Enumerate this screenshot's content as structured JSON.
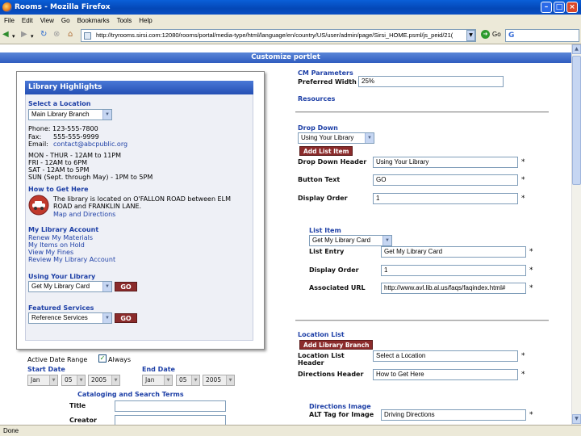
{
  "window": {
    "title": "Rooms - Mozilla Firefox",
    "controls": {
      "minimize": "–",
      "maximize": "□",
      "close": "×"
    }
  },
  "menubar": {
    "items": [
      "File",
      "Edit",
      "View",
      "Go",
      "Bookmarks",
      "Tools",
      "Help"
    ]
  },
  "navbar": {
    "url": "http://tryrooms.sirsi.com:12080/rooms/portal/media-type/html/language/en/country/US/user/admin/page/Sirsi_HOME.psml/js_peid/21(",
    "go_label": "Go",
    "search_logo": "G"
  },
  "status": {
    "text": "Done"
  },
  "portlet": {
    "title": "Customize portlet"
  },
  "library": {
    "header": "Library Highlights",
    "select_location_label": "Select a Location",
    "branch": "Main Library Branch",
    "phone": "Phone: 123-555-7800",
    "fax_label": "Fax:",
    "fax": "555-555-9999",
    "email_label": "Email:",
    "email": "contact@abcpublic.org",
    "hours": [
      "MON - THUR - 12AM to 11PM",
      "FRI - 12AM to 6PM",
      "SAT - 12AM to 5PM",
      "SUN (Sept. through May) - 1PM to 5PM"
    ],
    "how_heading": "How to Get Here",
    "how_text_1": "The library is located on O'FALLON ROAD between ELM",
    "how_text_2": "ROAD and FRANKLIN LANE.",
    "how_link": "Map and Directions",
    "account_heading": "My Library Account",
    "account_links": [
      "Renew My Materials",
      "My Items on Hold",
      "View My Fines",
      "Review My Library Account"
    ],
    "using_heading": "Using Your Library",
    "using_value": "Get My Library Card",
    "go": "GO",
    "featured_heading": "Featured Services",
    "featured_value": "Reference Services"
  },
  "date_range": {
    "active_label": "Active Date Range",
    "always_label": "Always",
    "always_checked": true,
    "start_label": "Start Date",
    "end_label": "End Date",
    "start": {
      "month": "Jan",
      "day": "05",
      "year": "2005"
    },
    "end": {
      "month": "Jan",
      "day": "05",
      "year": "2005"
    }
  },
  "catalog": {
    "heading": "Cataloging and Search Terms",
    "title_label": "Title",
    "creator_label": "Creator",
    "title_value": "",
    "creator_value": ""
  },
  "cm": {
    "heading": "CM Parameters",
    "width_label": "Preferred Width",
    "width_value": "25%",
    "resources": "Resources"
  },
  "dropdown": {
    "heading": "Drop Down",
    "select_value": "Using Your Library",
    "add_item_btn": "Add List Item",
    "header_label": "Drop Down Header",
    "header_value": "Using Your Library",
    "button_label": "Button Text",
    "button_value": "GO",
    "order_label": "Display Order",
    "order_value": "1"
  },
  "list_item": {
    "heading": "List Item",
    "select_value": "Get My Library Card",
    "entry_label": "List Entry",
    "entry_value": "Get My Library Card",
    "order_label": "Display Order",
    "order_value": "1",
    "url_label": "Associated URL",
    "url_value": "http://www.avl.lib.al.us/faqs/faqindex.html#"
  },
  "location_list": {
    "heading": "Location List",
    "add_branch_btn": "Add Library Branch",
    "header_label_1": "Location List",
    "header_label_2": "Header",
    "header_value": "Select a Location",
    "directions_label": "Directions Header",
    "directions_value": "How to Get Here"
  },
  "directions_image": {
    "heading": "Directions Image",
    "alt_label": "ALT Tag for Image",
    "alt_value": "Driving Directions"
  },
  "required_mark": "*"
}
